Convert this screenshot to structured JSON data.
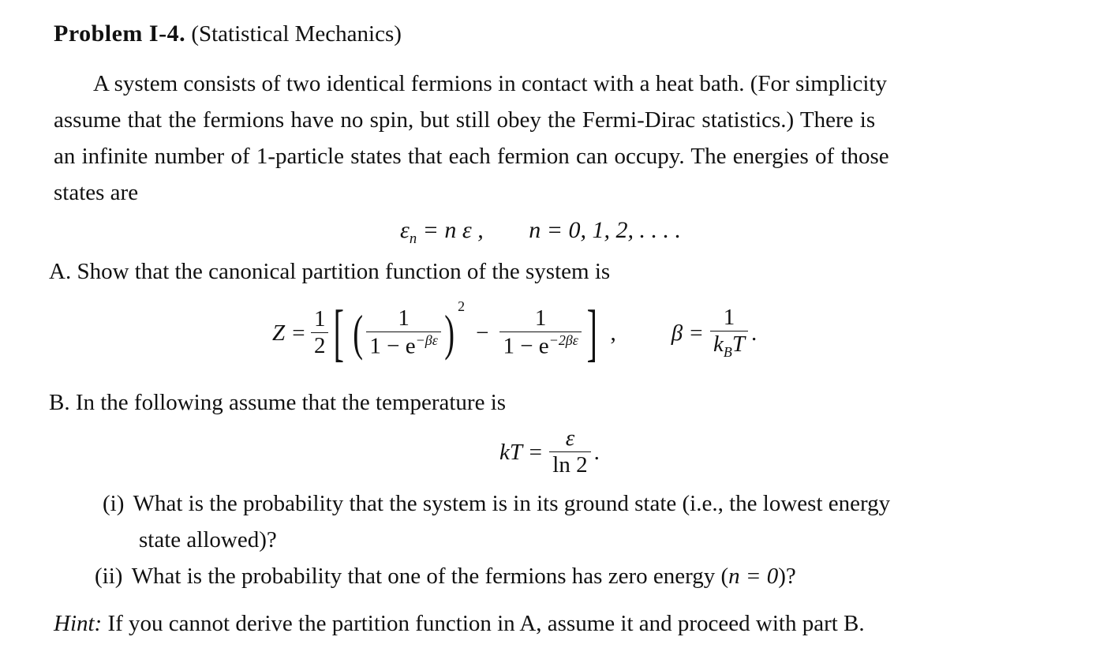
{
  "problem": {
    "label": "Problem I-4.",
    "subject": "(Statistical Mechanics)"
  },
  "intro": {
    "lines": [
      "A system consists of two identical fermions in contact with a heat bath. (For simplicity",
      "assume that the fermions have no spin, but still obey the Fermi-Dirac statistics.) There is",
      "an infinite number of 1-particle states that each fermion can occupy. The energies of those",
      "states are"
    ]
  },
  "eq_energies": {
    "lhs_symbol": "ε",
    "lhs_sub": "n",
    "rhs": "= n ε ,",
    "cond": "n = 0, 1, 2, . . . ."
  },
  "partA": {
    "text": "A. Show that the canonical partition function of the system is",
    "eq": {
      "lhs": "Z =",
      "half_num": "1",
      "half_den": "2",
      "frac1_num": "1",
      "frac1_den_base": "1 − e",
      "frac1_den_exp": "−βε",
      "power": "2",
      "minus": "−",
      "frac2_num": "1",
      "frac2_den_base": "1 − e",
      "frac2_den_exp": "−2βε",
      "comma": ",",
      "beta_lhs": "β =",
      "beta_num": "1",
      "beta_den_k": "k",
      "beta_den_sub": "B",
      "beta_den_T": "T",
      "period": "."
    }
  },
  "partB": {
    "text": "B. In the following assume that the temperature is",
    "eq": {
      "lhs": "kT =",
      "num": "ε",
      "den": "ln 2",
      "period": "."
    },
    "items": [
      {
        "marker": "(i)",
        "lines": [
          "What is the probability that the system is in its ground state (i.e., the lowest energy",
          "state allowed)?"
        ]
      },
      {
        "marker": "(ii)",
        "text_before": "What is the probability that one of the fermions has zero energy (",
        "math": "n = 0",
        "text_after": ")?"
      }
    ]
  },
  "hint": {
    "label": "Hint:",
    "text": "If you cannot derive the partition function in A, assume it and proceed with part B."
  }
}
